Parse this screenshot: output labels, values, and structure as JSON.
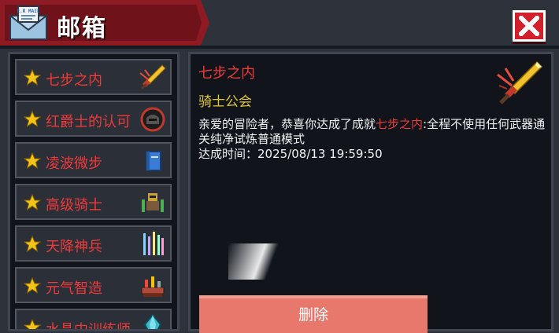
{
  "window": {
    "title": "邮箱",
    "mail_icon_text": "E.R MAIL"
  },
  "close_button": {
    "icon": "close-icon"
  },
  "mail_list": [
    {
      "label": "七步之内",
      "icon": "sword-icon"
    },
    {
      "label": "红爵士的认可",
      "icon": "helmet-icon"
    },
    {
      "label": "凌波微步",
      "icon": "book-icon"
    },
    {
      "label": "高级骑士",
      "icon": "knight-icon"
    },
    {
      "label": "天降神兵",
      "icon": "weapons-icon"
    },
    {
      "label": "元气智造",
      "icon": "workbench-icon"
    },
    {
      "label": "水晶中训练师",
      "icon": "crystal-icon"
    }
  ],
  "detail": {
    "title": "七步之内",
    "sender": "骑士公会",
    "body_prefix": "亲爱的冒险者，恭喜你达成了成就",
    "body_highlight": "七步之内",
    "body_suffix": ":全程不使用任何武器通关纯净试炼普通模式",
    "time_label": "达成时间：",
    "time_value": "2025/08/13 19:59:50",
    "icon": "sword-icon"
  },
  "delete_button": {
    "label": "删除"
  },
  "colors": {
    "accent_red": "#ef3a3a",
    "sender_gold": "#e0c53a",
    "delete_button": "#e7786b",
    "banner": "#8e1b23"
  }
}
